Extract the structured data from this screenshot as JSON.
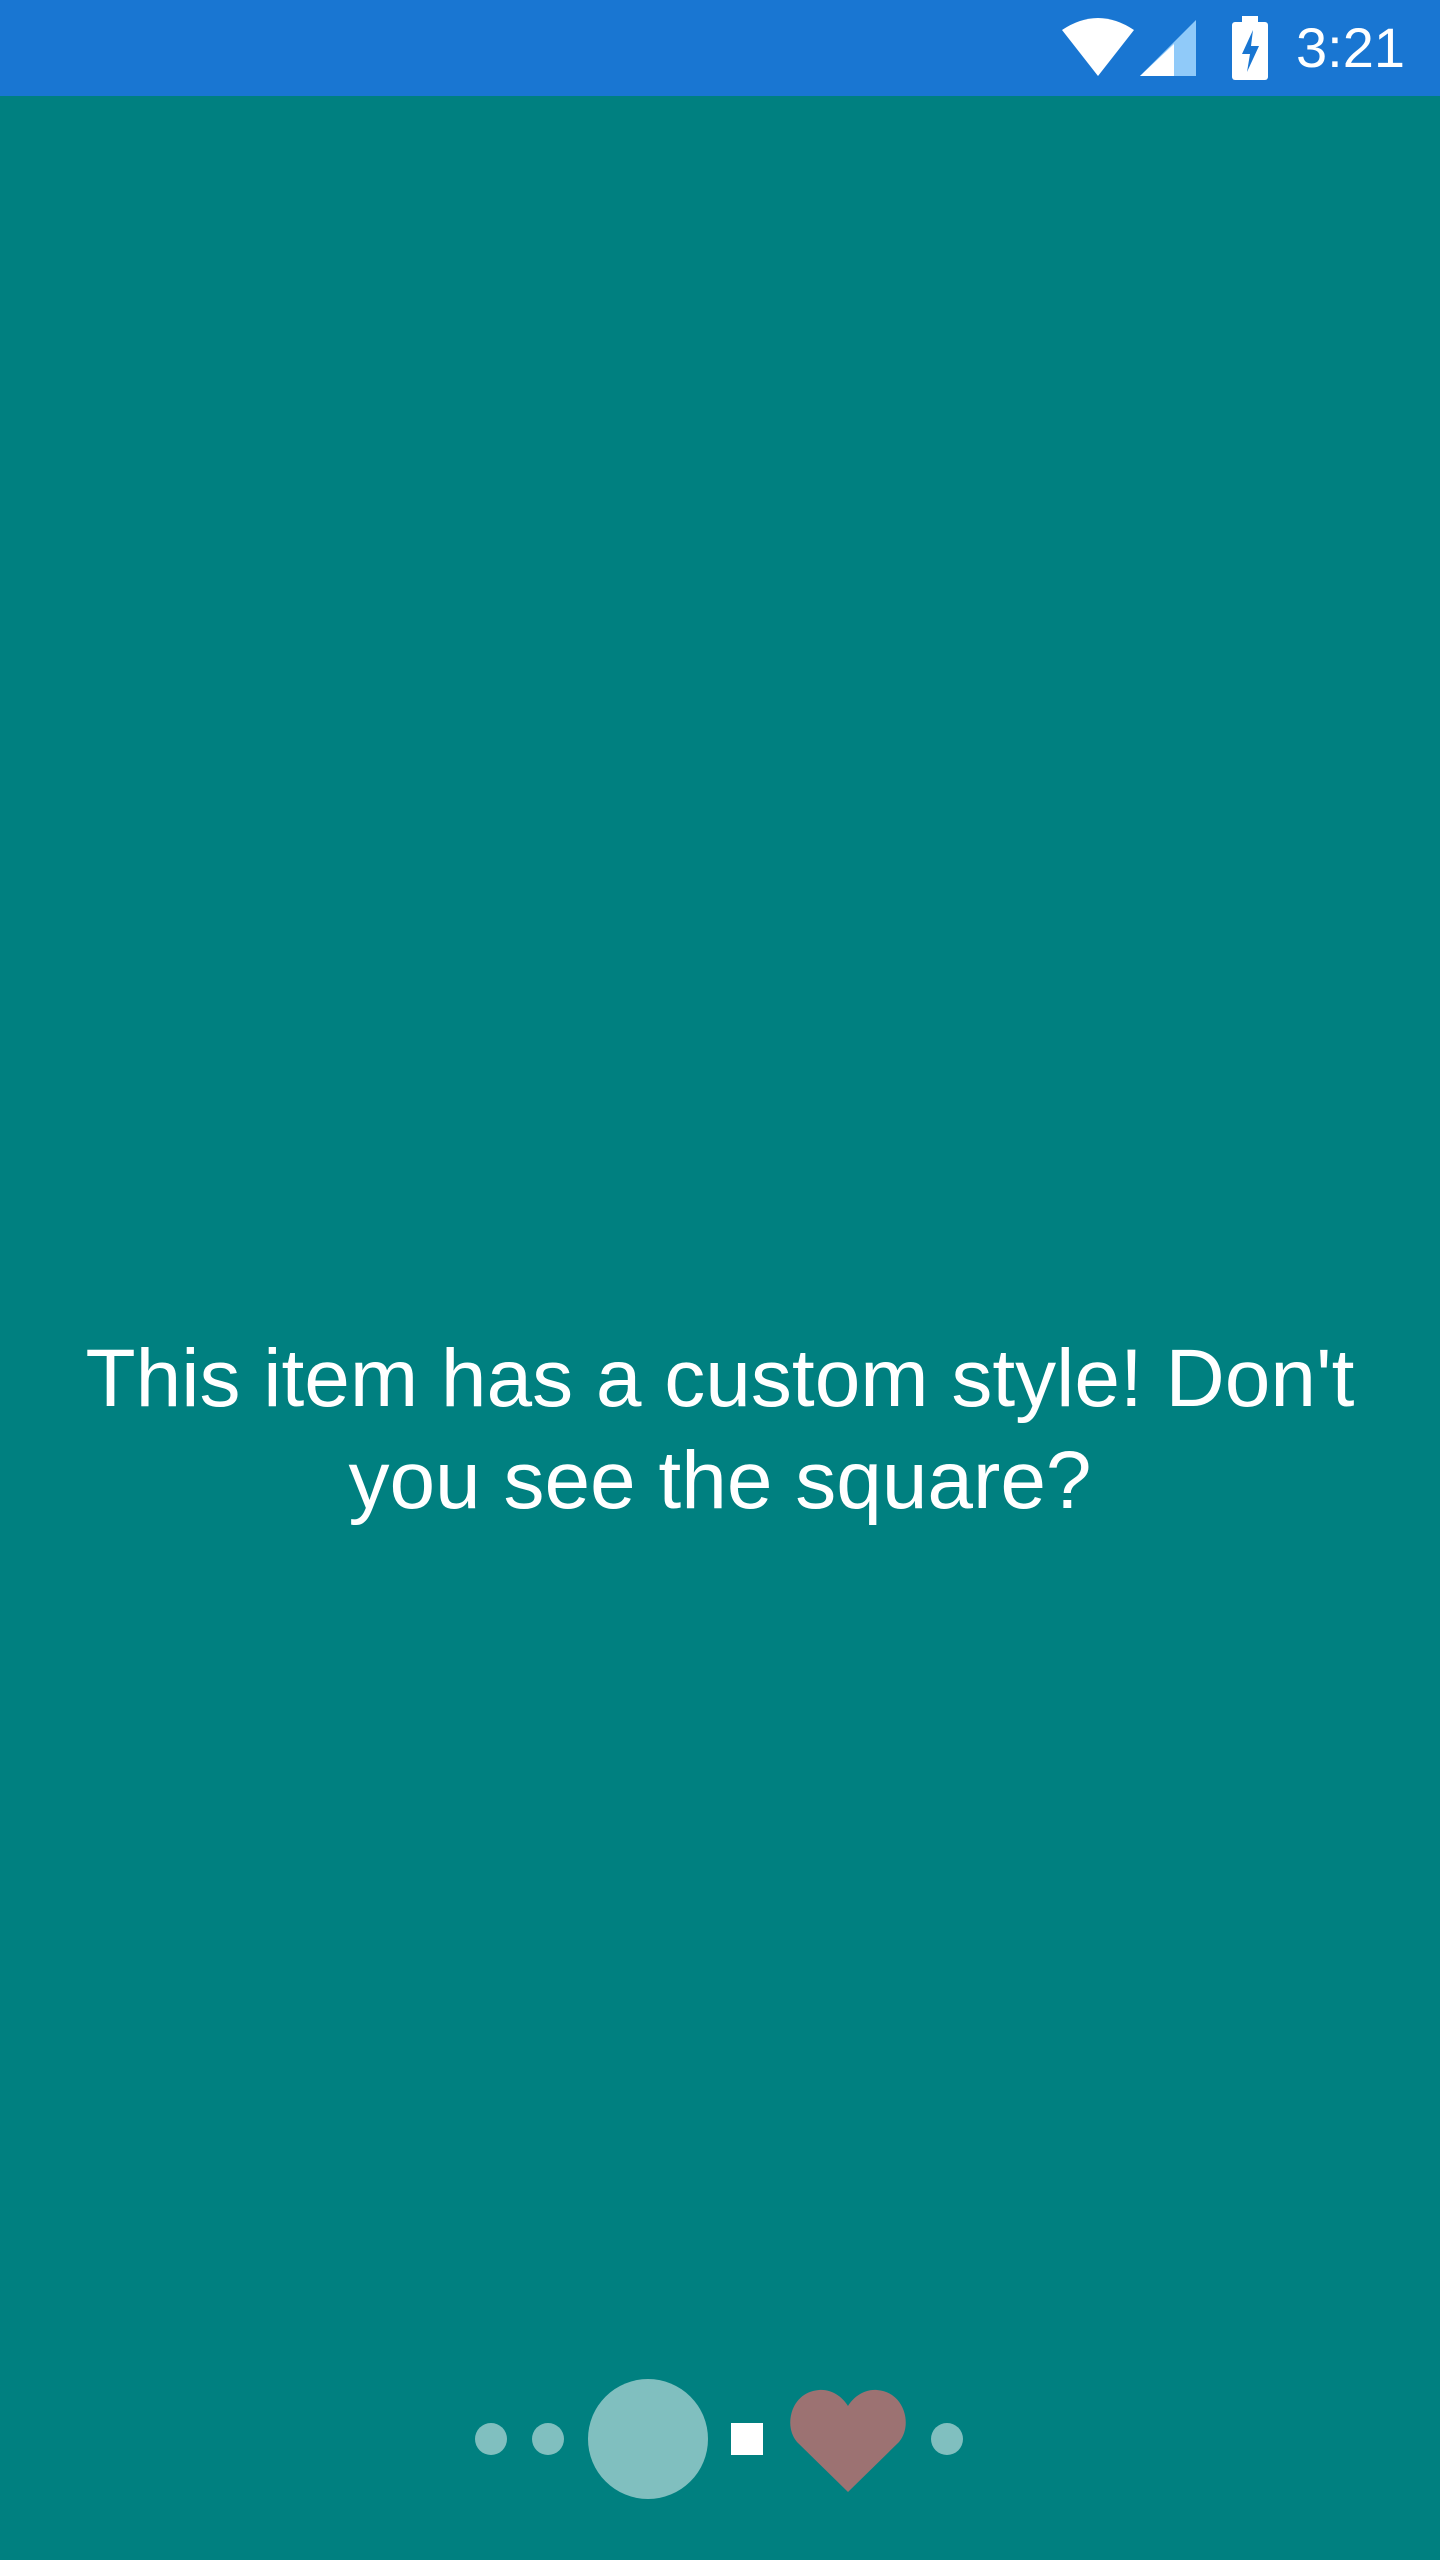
{
  "status_bar": {
    "time": "3:21",
    "background_color": "#1976D2",
    "icons": [
      "wifi-icon",
      "cellular-signal-icon",
      "battery-charging-icon"
    ]
  },
  "page": {
    "background_color": "#008080",
    "message": "This item has a custom style! Don't you see the square?"
  },
  "page_indicator": {
    "page_count": 6,
    "active_index": 2,
    "colors": {
      "inactive": "#80BFBF",
      "active": "#80BFBF",
      "square": "#FFFFFF",
      "heart": "#9C7272"
    },
    "items": [
      {
        "shape": "dot",
        "state": "inactive"
      },
      {
        "shape": "dot",
        "state": "inactive"
      },
      {
        "shape": "circle",
        "state": "active"
      },
      {
        "shape": "square",
        "state": "custom"
      },
      {
        "shape": "heart",
        "state": "custom"
      },
      {
        "shape": "dot",
        "state": "inactive"
      }
    ]
  }
}
